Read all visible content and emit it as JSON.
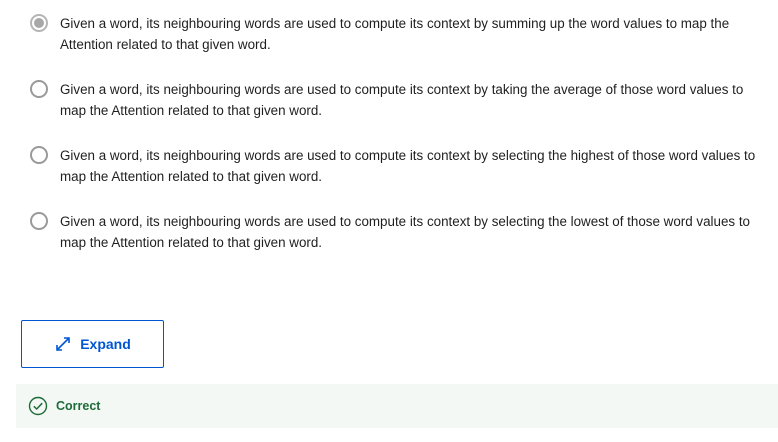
{
  "options": [
    {
      "text": "Given a word, its neighbouring words are used to compute its context by summing up the word values to map the Attention related to that given word.",
      "selected": true
    },
    {
      "text": "Given a word, its neighbouring words are used to compute its context by taking the average of those word values to map the Attention related to that given word.",
      "selected": false
    },
    {
      "text": "Given a word, its neighbouring words are used to compute its context by selecting the highest of those word values to map the Attention related to that given word.",
      "selected": false
    },
    {
      "text": "Given a word, its neighbouring words are used to compute its context by selecting the lowest of those word values to map the Attention related to that given word.",
      "selected": false
    }
  ],
  "expand": {
    "label": "Expand",
    "icon": "expand-arrows-icon",
    "color": "#0056d2"
  },
  "result": {
    "label": "Correct",
    "icon": "check-circle-icon",
    "color": "#1e6b3a"
  }
}
